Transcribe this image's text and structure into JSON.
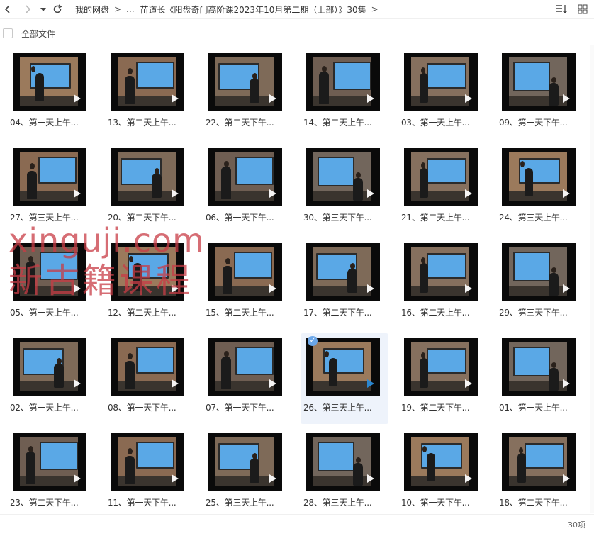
{
  "nav": {
    "breadcrumb": [
      {
        "label": "我的网盘"
      },
      {
        "label": "..."
      },
      {
        "label": "苗道长《阳盘奇门高阶课2023年10月第二期（上部）》30集"
      }
    ]
  },
  "toolbar": {
    "select_all_label": "全部文件"
  },
  "files": [
    {
      "label": "04、第一天上午...",
      "scene": 0
    },
    {
      "label": "13、第二天上午...",
      "scene": 1
    },
    {
      "label": "22、第二天下午...",
      "scene": 2
    },
    {
      "label": "14、第二天上午...",
      "scene": 3
    },
    {
      "label": "03、第一天上午...",
      "scene": 4
    },
    {
      "label": "09、第一天下午...",
      "scene": 5
    },
    {
      "label": "27、第三天上午...",
      "scene": 1
    },
    {
      "label": "20、第二天下午...",
      "scene": 2
    },
    {
      "label": "06、第一天下午...",
      "scene": 3
    },
    {
      "label": "30、第三天下午...",
      "scene": 5
    },
    {
      "label": "21、第二天上午...",
      "scene": 4
    },
    {
      "label": "24、第三天上午...",
      "scene": 0
    },
    {
      "label": "05、第一天上午...",
      "scene": 3
    },
    {
      "label": "12、第二天上午...",
      "scene": 0
    },
    {
      "label": "15、第二天上午...",
      "scene": 1
    },
    {
      "label": "17、第二天下午...",
      "scene": 2
    },
    {
      "label": "16、第二天上午...",
      "scene": 4
    },
    {
      "label": "29、第三天下午...",
      "scene": 5
    },
    {
      "label": "02、第一天上午...",
      "scene": 2
    },
    {
      "label": "08、第一天下午...",
      "scene": 1
    },
    {
      "label": "07、第一天下午...",
      "scene": 3
    },
    {
      "label": "26、第三天上午...",
      "scene": 0,
      "selected": true
    },
    {
      "label": "19、第二天下午...",
      "scene": 4
    },
    {
      "label": "01、第一天上午...",
      "scene": 5
    },
    {
      "label": "23、第二天下午...",
      "scene": 3
    },
    {
      "label": "11、第一天下午...",
      "scene": 1
    },
    {
      "label": "25、第三天上午...",
      "scene": 2
    },
    {
      "label": "28、第三天上午...",
      "scene": 5
    },
    {
      "label": "10、第一天下午...",
      "scene": 0
    },
    {
      "label": "18、第二天下午...",
      "scene": 4
    }
  ],
  "watermark": {
    "line1": "xinguji.com",
    "line2": "新古籍课程"
  },
  "footer": {
    "count": "30项"
  },
  "colors": {
    "board": "#5aa8e6",
    "selected_bg": "#eef3fb",
    "accent": "#2a8bd8"
  }
}
